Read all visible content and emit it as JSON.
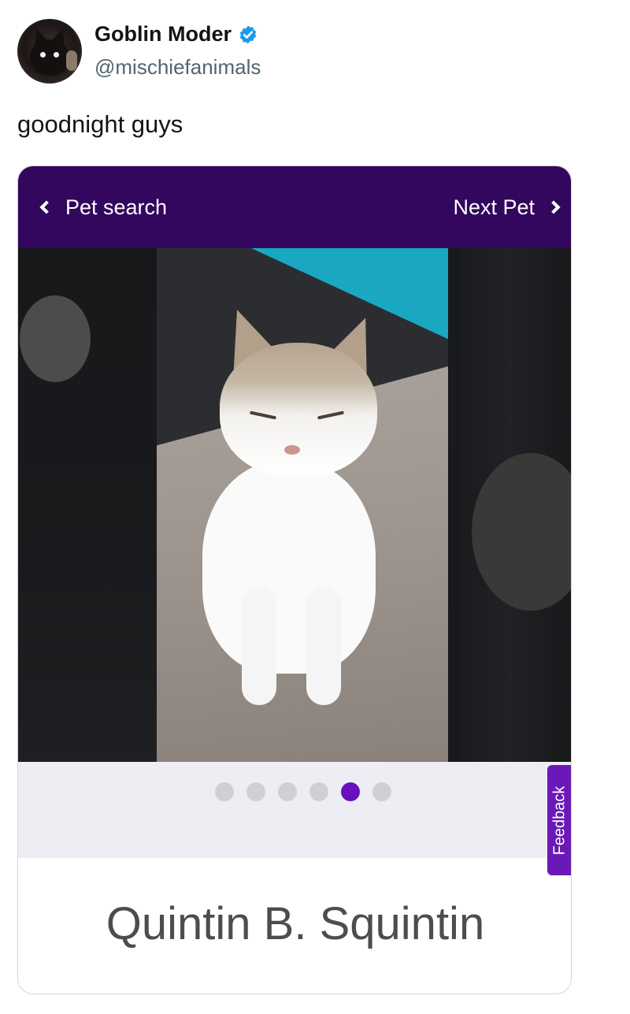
{
  "tweet": {
    "display_name": "Goblin Moder",
    "handle": "@mischiefanimals",
    "verified_icon": "verified-badge-icon",
    "text": "goodnight guys"
  },
  "card": {
    "nav": {
      "back_label": "Pet search",
      "next_label": "Next Pet"
    },
    "carousel": {
      "total": 6,
      "active_index": 4
    },
    "feedback_label": "Feedback",
    "pet_name": "Quintin B. Squintin",
    "colors": {
      "topbar": "#33075e",
      "active_dot": "#6a0fbf",
      "feedback_tab": "#6a18b7",
      "verified": "#1d9bf0"
    }
  }
}
